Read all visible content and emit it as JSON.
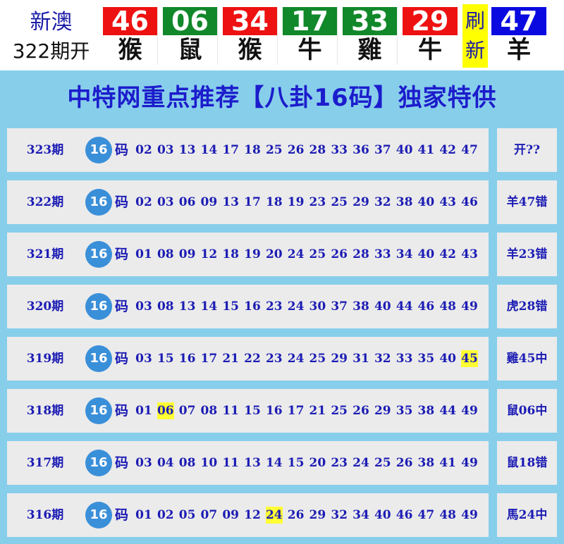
{
  "header": {
    "site_name": "新澳",
    "issue_label": "322期开",
    "refresh_label": [
      "刷",
      "新"
    ],
    "balls": [
      {
        "number": "46",
        "zodiac": "猴",
        "color": "#ee1111"
      },
      {
        "number": "06",
        "zodiac": "鼠",
        "color": "#11882a"
      },
      {
        "number": "34",
        "zodiac": "猴",
        "color": "#ee1111"
      },
      {
        "number": "17",
        "zodiac": "牛",
        "color": "#11882a"
      },
      {
        "number": "33",
        "zodiac": "雞",
        "color": "#11882a"
      },
      {
        "number": "29",
        "zodiac": "牛",
        "color": "#ee1111"
      },
      {
        "number": "47",
        "zodiac": "羊",
        "color": "#0a0ae0"
      }
    ]
  },
  "banner": {
    "title": "中特网重点推荐【八卦16码】独家特供"
  },
  "code_badge": "16",
  "code_unit": "码",
  "colors": {
    "highlight": "#ffff33",
    "band": "#87ceeb",
    "text_blue": "#1c1cb4"
  },
  "rows": [
    {
      "period": "323期",
      "numbers": [
        "02",
        "03",
        "13",
        "14",
        "17",
        "18",
        "25",
        "26",
        "28",
        "33",
        "36",
        "37",
        "40",
        "41",
        "42",
        "47"
      ],
      "hit": null,
      "result": "开??"
    },
    {
      "period": "322期",
      "numbers": [
        "02",
        "03",
        "06",
        "09",
        "13",
        "17",
        "18",
        "19",
        "23",
        "25",
        "29",
        "32",
        "38",
        "40",
        "43",
        "46"
      ],
      "hit": null,
      "result": "羊47错"
    },
    {
      "period": "321期",
      "numbers": [
        "01",
        "08",
        "09",
        "12",
        "18",
        "19",
        "20",
        "24",
        "25",
        "26",
        "28",
        "33",
        "34",
        "40",
        "42",
        "43"
      ],
      "hit": null,
      "result": "羊23错"
    },
    {
      "period": "320期",
      "numbers": [
        "03",
        "08",
        "13",
        "14",
        "15",
        "16",
        "23",
        "24",
        "30",
        "37",
        "38",
        "40",
        "44",
        "46",
        "48",
        "49"
      ],
      "hit": null,
      "result": "虎28错"
    },
    {
      "period": "319期",
      "numbers": [
        "03",
        "15",
        "16",
        "17",
        "21",
        "22",
        "23",
        "24",
        "25",
        "29",
        "31",
        "32",
        "33",
        "35",
        "40",
        "45"
      ],
      "hit": "45",
      "result": "雞45中"
    },
    {
      "period": "318期",
      "numbers": [
        "01",
        "06",
        "07",
        "08",
        "11",
        "15",
        "16",
        "17",
        "21",
        "25",
        "26",
        "29",
        "35",
        "38",
        "44",
        "49"
      ],
      "hit": "06",
      "result": "鼠06中"
    },
    {
      "period": "317期",
      "numbers": [
        "03",
        "04",
        "08",
        "10",
        "11",
        "13",
        "14",
        "15",
        "20",
        "23",
        "24",
        "25",
        "26",
        "38",
        "41",
        "49"
      ],
      "hit": null,
      "result": "鼠18错"
    },
    {
      "period": "316期",
      "numbers": [
        "01",
        "02",
        "05",
        "07",
        "09",
        "12",
        "24",
        "26",
        "29",
        "32",
        "34",
        "40",
        "46",
        "47",
        "48",
        "49"
      ],
      "hit": "24",
      "result": "馬24中"
    }
  ]
}
